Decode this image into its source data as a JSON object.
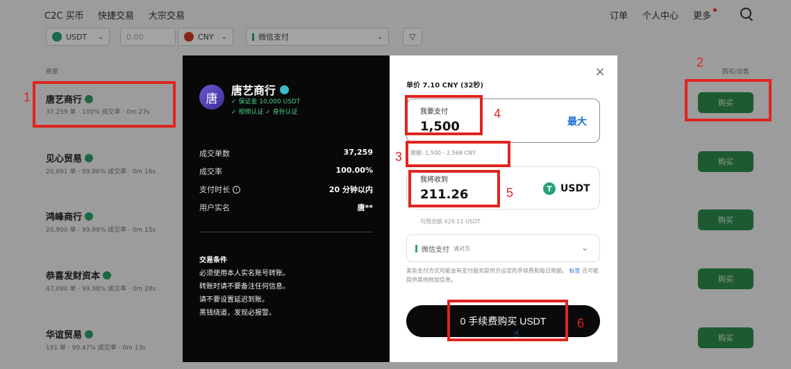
{
  "topnav": {
    "left": [
      "C2C 买币",
      "快捷交易",
      "大宗交易"
    ],
    "right": [
      "订单",
      "个人中心",
      "更多"
    ]
  },
  "filters": {
    "coin": "USDT",
    "amount_placeholder": "0.00",
    "currency": "CNY",
    "payment": "微信支付"
  },
  "columns": {
    "merchant": "商家",
    "action": "购买/出售"
  },
  "merchants": [
    {
      "name": "唐艺商行",
      "stats": "37,259 单 · 100% 成交率 · 0m 27s"
    },
    {
      "name": "见心贸易",
      "stats": "20,891 单 · 99.96% 成交率 · 0m 16s"
    },
    {
      "name": "鸿峰商行",
      "stats": "20,900 单 · 99.99% 成交率 · 0m 15s"
    },
    {
      "name": "恭喜发财资本",
      "stats": "47,090 单 · 99.98% 成交率 · 0m 28s"
    },
    {
      "name": "华谊贸易",
      "stats": "191 单 · 99.47% 成交率 · 0m 13s"
    }
  ],
  "buy_label": "购买",
  "modal": {
    "avatar_char": "唐",
    "merchant_name": "唐艺商行",
    "deposit": "✓ 保证金 10,000 USDT",
    "verify": "✓ 视频认证   ✓ 身份认证",
    "stats": [
      {
        "k": "成交单数",
        "v": "37,259"
      },
      {
        "k": "成交率",
        "v": "100.00%"
      },
      {
        "k": "支付时长",
        "v": "20 分钟以内"
      },
      {
        "k": "用户实名",
        "v": "唐**"
      }
    ],
    "conditions_title": "交易条件",
    "conditions": [
      "必须使用本人实名账号转账。",
      "转账时请不要备注任何信息。",
      "请不要设置延迟到账。",
      "黑钱绕道，发现必报警。"
    ],
    "unit_price": "单价 7.10 CNY (32秒)",
    "pay_label": "我要支付",
    "pay_value": "1,500",
    "max_label": "最大",
    "limit": "限额: 1,500 - 2,568 CNY",
    "recv_label": "我将收到",
    "recv_value": "211.26",
    "recv_coin": "USDT",
    "available": "可用余额 429.11 USDT",
    "method": "微信支付",
    "method_sub": "请对方",
    "note": "某些支付方式可能会有支付服务提供方设定的手续费和每日限额。",
    "note_link": "标签",
    "note_tail": "还可能提供其他附加信息。",
    "cta": "0 手续费购买 USDT"
  },
  "annotations": [
    "1",
    "2",
    "3",
    "4",
    "5",
    "6"
  ]
}
